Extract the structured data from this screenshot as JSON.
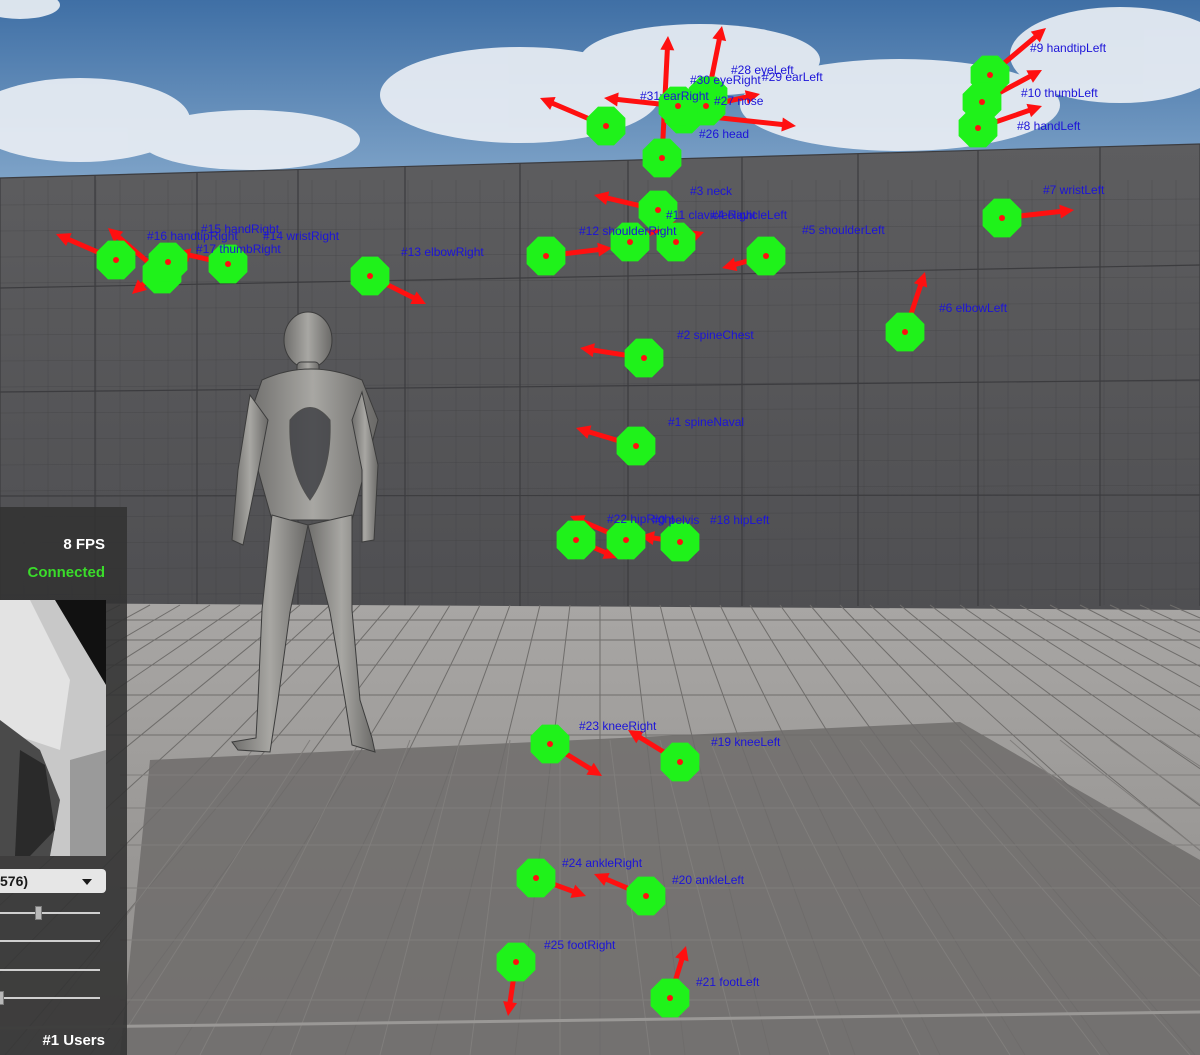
{
  "joints": [
    {
      "id": 0,
      "label": "#0 pelvis"
    },
    {
      "id": 1,
      "label": "#1 spineNaval"
    },
    {
      "id": 2,
      "label": "#2 spineChest"
    },
    {
      "id": 3,
      "label": "#3 neck"
    },
    {
      "id": 4,
      "label": "#4 clavicleLeft"
    },
    {
      "id": 5,
      "label": "#5 shoulderLeft"
    },
    {
      "id": 6,
      "label": "#6 elbowLeft"
    },
    {
      "id": 7,
      "label": "#7 wristLeft"
    },
    {
      "id": 8,
      "label": "#8 handLeft"
    },
    {
      "id": 9,
      "label": "#9 handtipLeft"
    },
    {
      "id": 10,
      "label": "#10 thumbLeft"
    },
    {
      "id": 11,
      "label": "#11 clavicleRight"
    },
    {
      "id": 12,
      "label": "#12 shoulderRight"
    },
    {
      "id": 13,
      "label": "#13 elbowRight"
    },
    {
      "id": 14,
      "label": "#14 wristRight"
    },
    {
      "id": 15,
      "label": "#15 handRight"
    },
    {
      "id": 16,
      "label": "#16 handtipRight"
    },
    {
      "id": 17,
      "label": "#17 thumbRight"
    },
    {
      "id": 18,
      "label": "#18 hipLeft"
    },
    {
      "id": 19,
      "label": "#19 kneeLeft"
    },
    {
      "id": 20,
      "label": "#20 ankleLeft"
    },
    {
      "id": 21,
      "label": "#21 footLeft"
    },
    {
      "id": 22,
      "label": "#22 hipRight"
    },
    {
      "id": 23,
      "label": "#23 kneeRight"
    },
    {
      "id": 24,
      "label": "#24 ankleRight"
    },
    {
      "id": 25,
      "label": "#25 footRight"
    },
    {
      "id": 26,
      "label": "#26 head"
    },
    {
      "id": 27,
      "label": "#27 nose"
    },
    {
      "id": 28,
      "label": "#28 eyeLeft"
    },
    {
      "id": 29,
      "label": "#29 earLeft"
    },
    {
      "id": 30,
      "label": "#30 eyeRight"
    },
    {
      "id": 31,
      "label": "#31 earRight"
    }
  ],
  "colors": {
    "joint_marker": "#1ff21a",
    "orientation_arrow": "#ff1010",
    "joint_label": "#1c14d8",
    "status_connected": "#3adc2a"
  },
  "panel": {
    "fps": "8 FPS",
    "status": "Connected",
    "dropdown_value": "576)",
    "users": "#1 Users",
    "sliders": [
      0.38,
      0.0,
      0.0,
      0.0
    ]
  }
}
